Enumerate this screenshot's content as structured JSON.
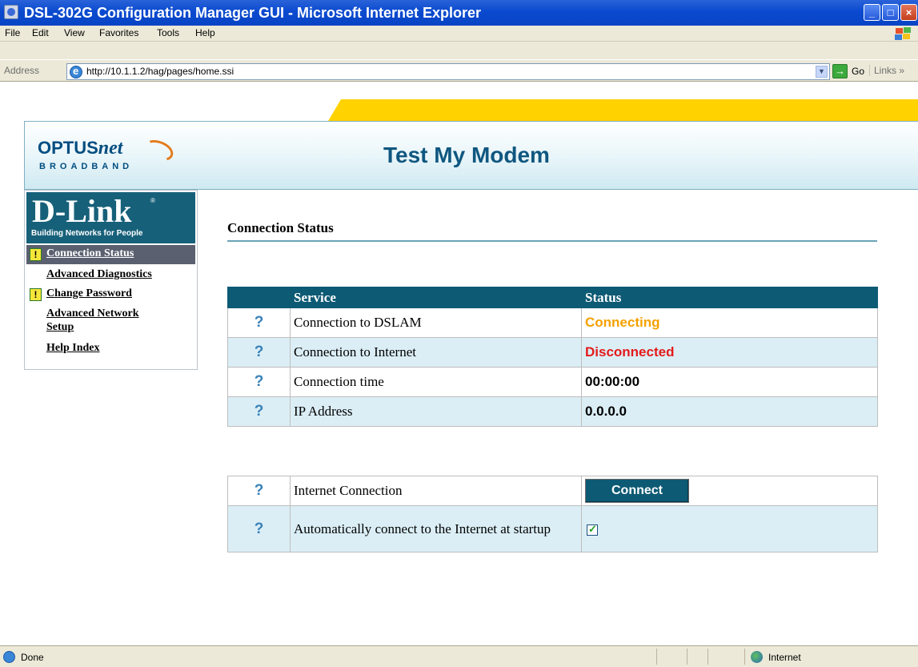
{
  "window": {
    "title": "DSL-302G Configuration Manager GUI - Microsoft Internet Explorer"
  },
  "menu": [
    {
      "label": "File"
    },
    {
      "label": "Edit"
    },
    {
      "label": "View"
    },
    {
      "label": "Favorites"
    },
    {
      "label": "Tools"
    },
    {
      "label": "Help"
    }
  ],
  "address": {
    "label": "Address",
    "url": "http://10.1.1.2/hag/pages/home.ssi",
    "go": "Go",
    "links": "Links"
  },
  "banner": {
    "logo_word1": "OPTUS",
    "logo_word2": "net",
    "logo_sub": "BROADBAND",
    "heading": "Test My Modem"
  },
  "dlink": {
    "brand": "D-Link",
    "reg": "®",
    "tagline": "Building Networks for People"
  },
  "sidebar": {
    "items": [
      {
        "label": "Connection Status",
        "active": true,
        "warn": true
      },
      {
        "label": "Advanced Diagnostics",
        "active": false,
        "warn": false
      },
      {
        "label": "Change Password",
        "active": false,
        "warn": true
      },
      {
        "label": "Advanced Network Setup",
        "active": false,
        "warn": false
      },
      {
        "label": "Help Index",
        "active": false,
        "warn": false
      }
    ]
  },
  "content": {
    "section_title": "Connection Status",
    "status_table": {
      "headers": [
        "Service",
        "Status"
      ],
      "rows": [
        {
          "service": "Connection to DSLAM",
          "status": "Connecting",
          "color": "#f5a100"
        },
        {
          "service": "Connection to Internet",
          "status": "Disconnected",
          "color": "#e41a1a"
        },
        {
          "service": "Connection time",
          "status": "00:00:00",
          "color": "#000000"
        },
        {
          "service": "IP Address",
          "status": "0.0.0.0",
          "color": "#000000"
        }
      ]
    },
    "connection": {
      "internet_label": "Internet Connection",
      "connect_button": "Connect",
      "auto_label": "Automatically connect to the Internet at startup",
      "auto_checked": true
    }
  },
  "statusbar": {
    "left": "Done",
    "zone": "Internet"
  },
  "colors": {
    "accent": "#0d5a74",
    "banner_text": "#0f5780",
    "yellow": "#ffd200"
  }
}
